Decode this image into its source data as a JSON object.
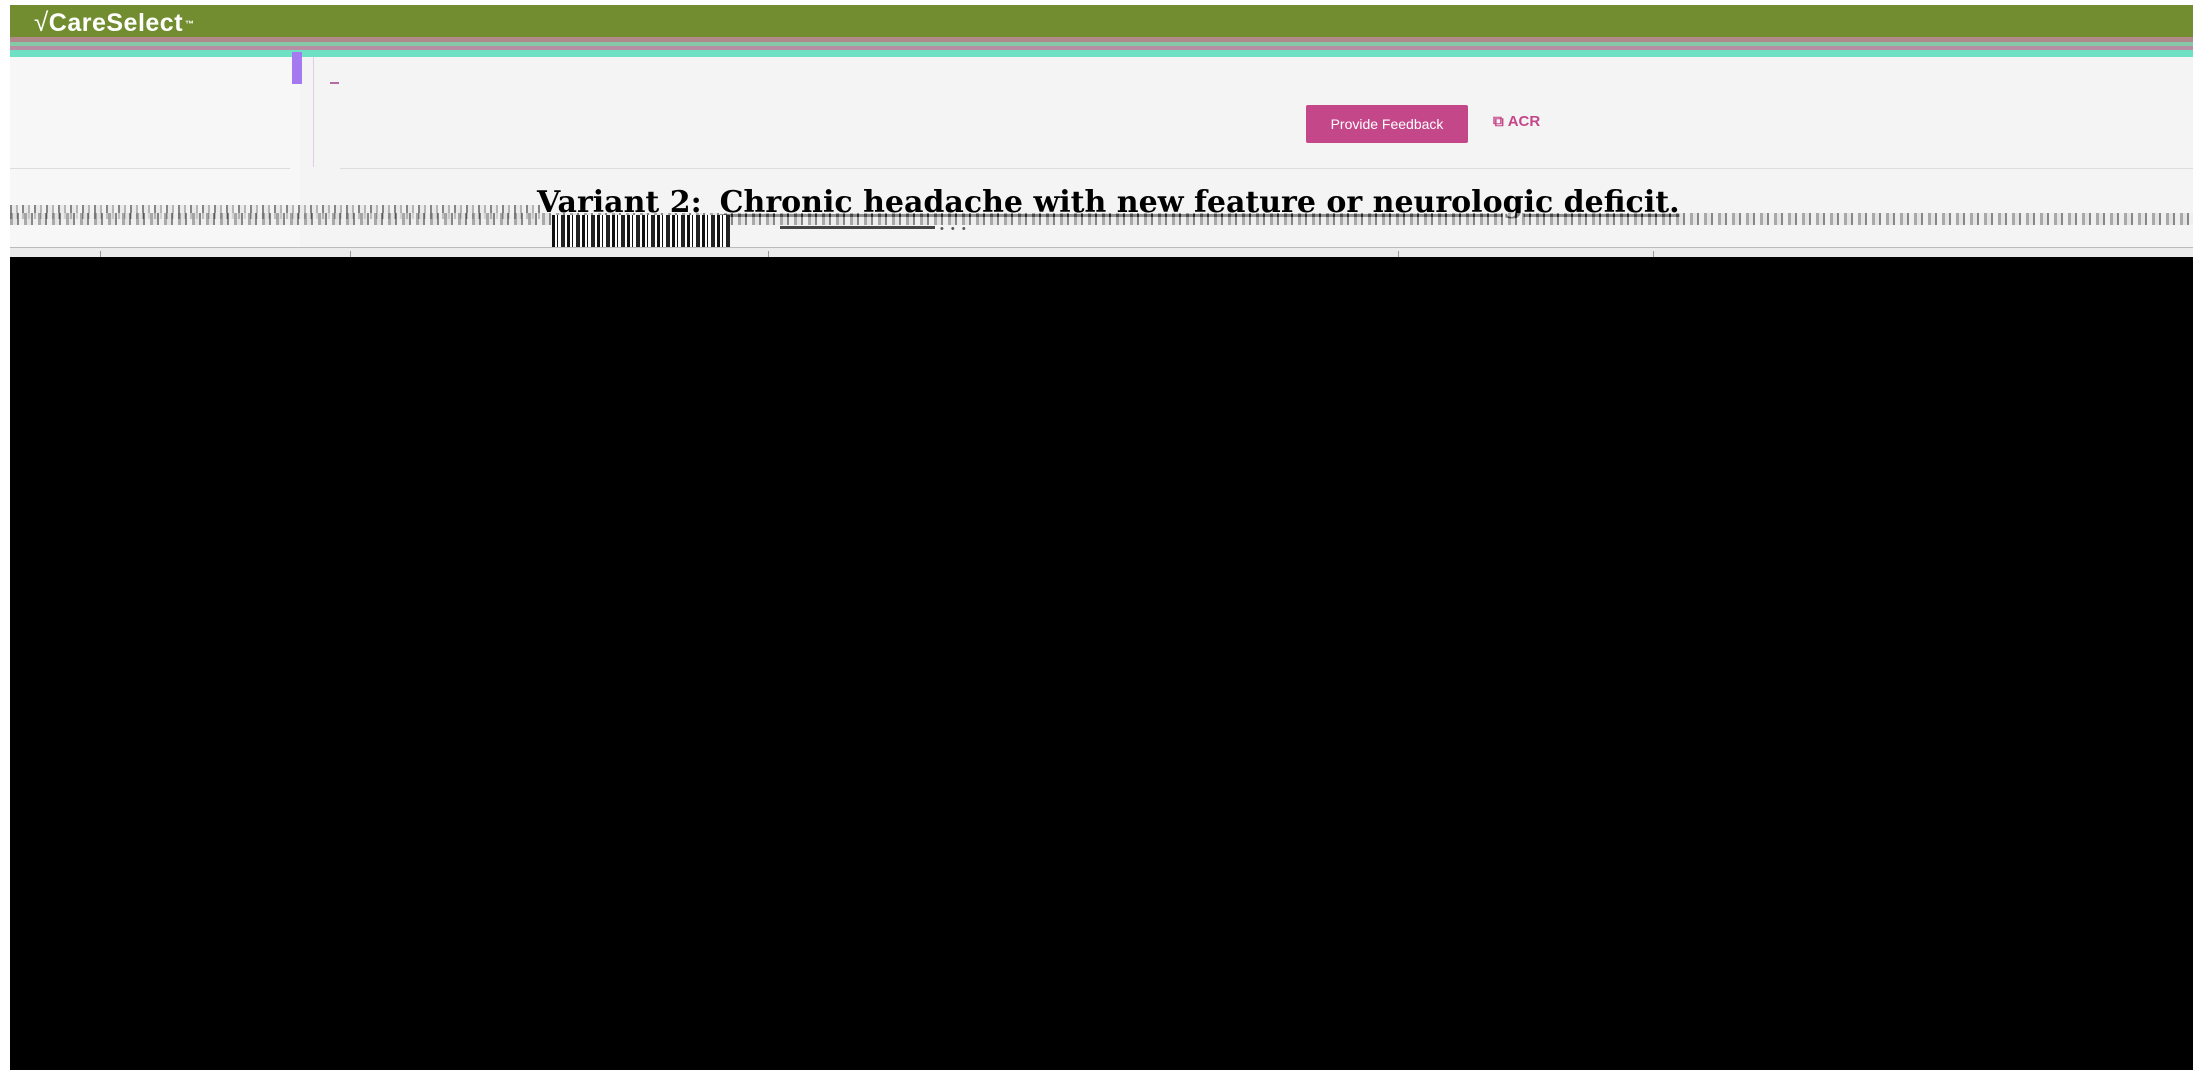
{
  "header": {
    "logo_check": "√",
    "logo_text": "CareSelect",
    "logo_tm": "™"
  },
  "toolbar": {
    "feedback_label": "Provide Feedback",
    "acr_label": "ACR",
    "acr_icon": "external-link-icon"
  },
  "main": {
    "variant_label": "Variant 2:",
    "title_text": "Chronic headache with new feature or neurologic deficit."
  },
  "colors": {
    "header_green": "#728d30",
    "accent_magenta": "#c4478a",
    "marker_purple": "#a57af0"
  }
}
